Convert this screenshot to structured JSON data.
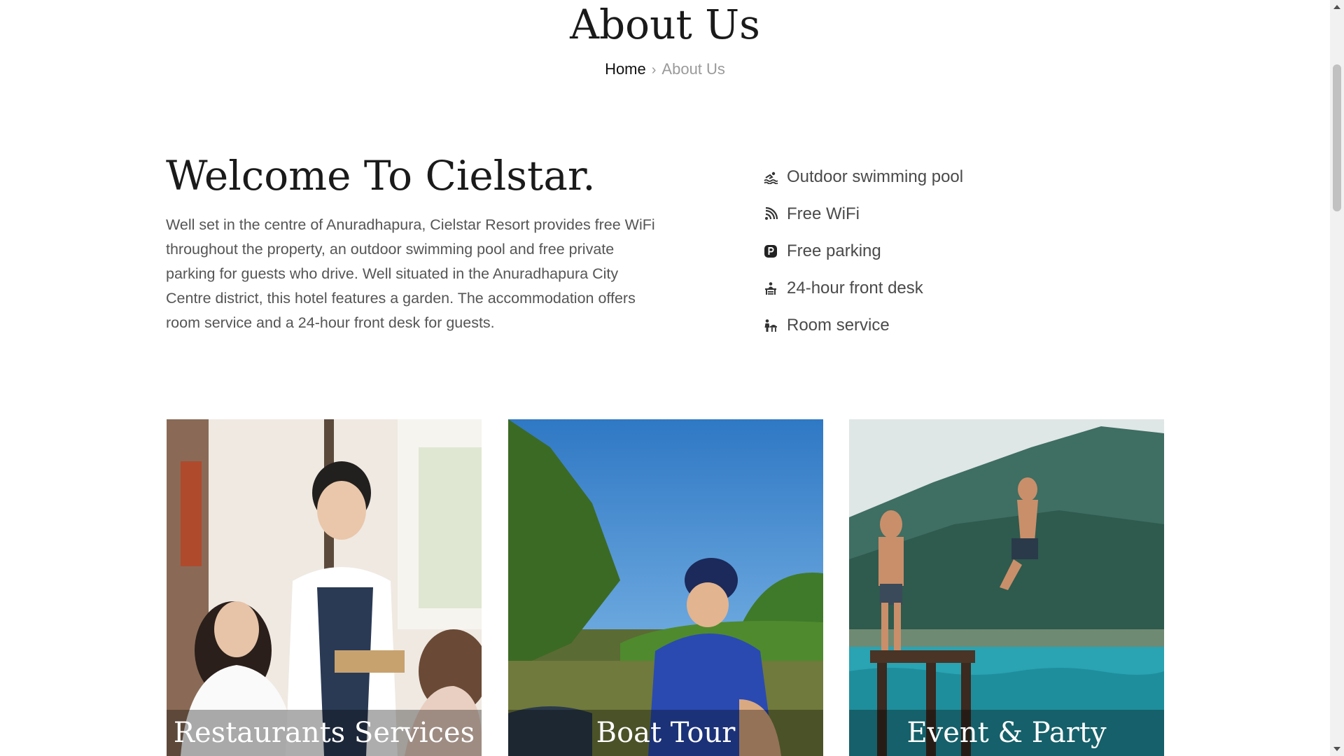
{
  "header": {
    "title": "About Us",
    "breadcrumb": {
      "home": "Home",
      "separator": "›",
      "current": "About Us"
    }
  },
  "welcome": {
    "title": "Welcome To Cielstar.",
    "text": "Well set in the centre of Anuradhapura, Cielstar Resort provides free WiFi throughout the property, an outdoor swimming pool and free private parking for guests who drive. Well situated in the Anuradhapura City Centre district, this hotel features a garden. The accommodation offers room service and a 24-hour front desk for guests."
  },
  "amenities": [
    {
      "icon": "swimming-icon",
      "label": "Outdoor swimming pool"
    },
    {
      "icon": "wifi-icon",
      "label": "Free WiFi"
    },
    {
      "icon": "parking-icon",
      "label": "Free parking"
    },
    {
      "icon": "front-desk-icon",
      "label": "24-hour front desk"
    },
    {
      "icon": "room-service-icon",
      "label": "Room service"
    }
  ],
  "cards": [
    {
      "caption": "Restaurants Services"
    },
    {
      "caption": "Boat Tour"
    },
    {
      "caption": "Event & Party"
    }
  ]
}
